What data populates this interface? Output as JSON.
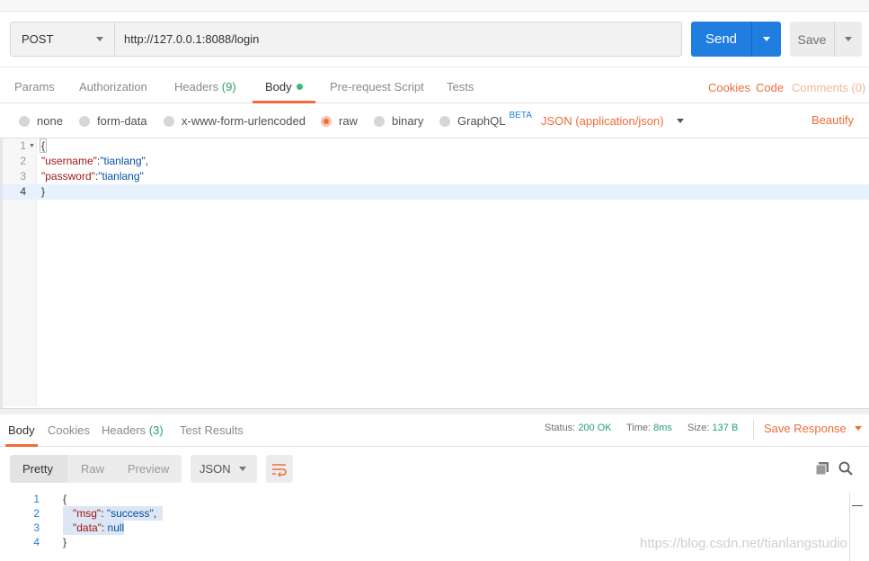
{
  "request": {
    "method": "POST",
    "url": "http://127.0.0.1:8088/login",
    "send_label": "Send",
    "save_label": "Save"
  },
  "request_tabs": [
    {
      "label": "Params"
    },
    {
      "label": "Authorization"
    },
    {
      "label": "Headers",
      "count": "(9)"
    },
    {
      "label": "Body"
    },
    {
      "label": "Pre-request Script"
    },
    {
      "label": "Tests"
    }
  ],
  "request_links": {
    "cookies": "Cookies",
    "code": "Code",
    "comments": "Comments (0)"
  },
  "body_types": [
    {
      "label": "none"
    },
    {
      "label": "form-data"
    },
    {
      "label": "x-www-form-urlencoded"
    },
    {
      "label": "raw",
      "selected": true
    },
    {
      "label": "binary"
    },
    {
      "label": "GraphQL",
      "badge": "BETA"
    }
  ],
  "content_type": "JSON (application/json)",
  "beautify_label": "Beautify",
  "editor_lines": [
    {
      "n": "1",
      "text": "{"
    },
    {
      "n": "2",
      "key": "\"username\"",
      "sep": ":",
      "value": "\"tianlang\"",
      "tail": ","
    },
    {
      "n": "3",
      "key": "\"password\"",
      "sep": ":",
      "value": "\"tianlang\"",
      "tail": ""
    },
    {
      "n": "4",
      "text": "}"
    }
  ],
  "response_tabs": [
    {
      "label": "Body"
    },
    {
      "label": "Cookies"
    },
    {
      "label": "Headers",
      "count": "(3)"
    },
    {
      "label": "Test Results"
    }
  ],
  "response_status": {
    "status_label": "Status:",
    "status_value": "200 OK",
    "time_label": "Time:",
    "time_value": "8ms",
    "size_label": "Size:",
    "size_value": "137 B",
    "save_response": "Save Response"
  },
  "view_modes": [
    "Pretty",
    "Raw",
    "Preview"
  ],
  "response_format": "JSON",
  "response_lines": [
    {
      "n": "1",
      "text": "{"
    },
    {
      "n": "2",
      "key": "\"msg\"",
      "sep": ": ",
      "value": "\"success\"",
      "tail": ","
    },
    {
      "n": "3",
      "key": "\"data\"",
      "sep": ": ",
      "value": "null",
      "tail": ""
    },
    {
      "n": "4",
      "text": "}"
    }
  ],
  "watermark": "https://blog.csdn.net/tianlangstudio",
  "colors": {
    "accent": "#f26b3a",
    "primary": "#1f7ee0",
    "success": "#26a26b"
  }
}
